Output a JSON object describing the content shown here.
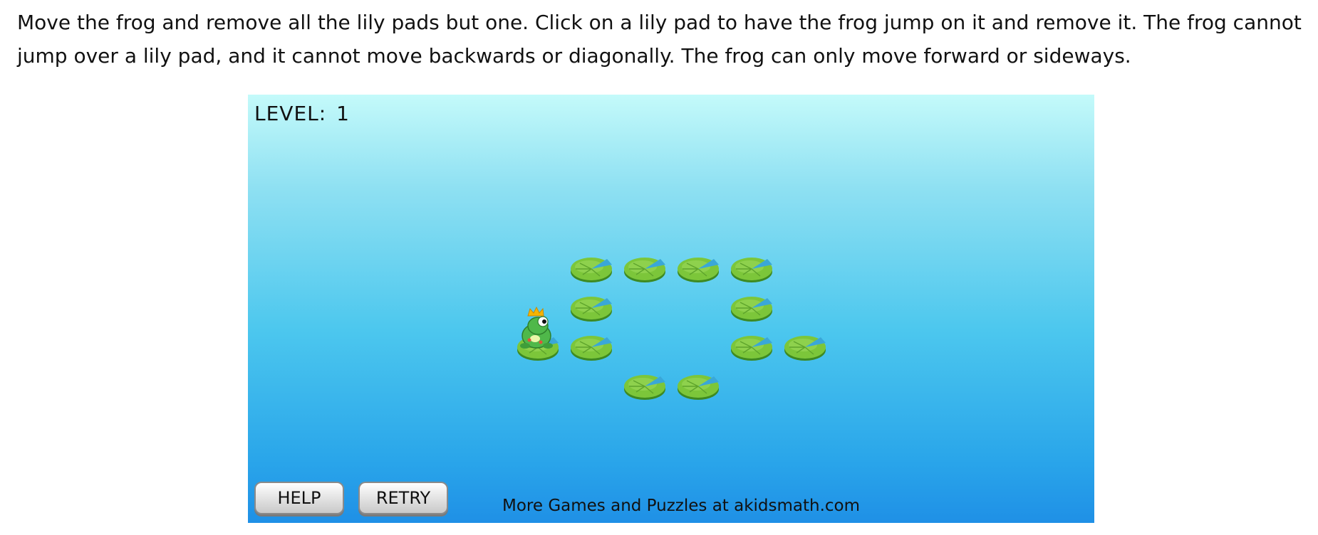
{
  "instructions": "Move the frog and remove all the lily pads but one. Click on a lily pad to have the frog jump on it and remove it. The frog cannot jump over a lily pad, and it cannot move backwards or diagonally. The frog can only move forward or sideways.",
  "level": {
    "label": "LEVEL:",
    "value": "1"
  },
  "buttons": {
    "help": "HELP",
    "retry": "RETRY"
  },
  "footer": "More Games and Puzzles at akidsmath.com",
  "board": {
    "frog_on": [
      0,
      2
    ],
    "lily_pads": [
      [
        1,
        0
      ],
      [
        2,
        0
      ],
      [
        3,
        0
      ],
      [
        4,
        0
      ],
      [
        1,
        1
      ],
      [
        4,
        1
      ],
      [
        1,
        2
      ],
      [
        4,
        2
      ],
      [
        5,
        2
      ],
      [
        2,
        3
      ],
      [
        3,
        3
      ]
    ]
  },
  "colors": {
    "pad": "#7cc63a",
    "water_top": "#c4fafa",
    "water_bottom": "#1f90e6",
    "frog": "#4fb84a",
    "crown": "#f5b400"
  },
  "icons": {
    "frog": "frog-with-crown-icon",
    "pad": "lily-pad-icon"
  }
}
